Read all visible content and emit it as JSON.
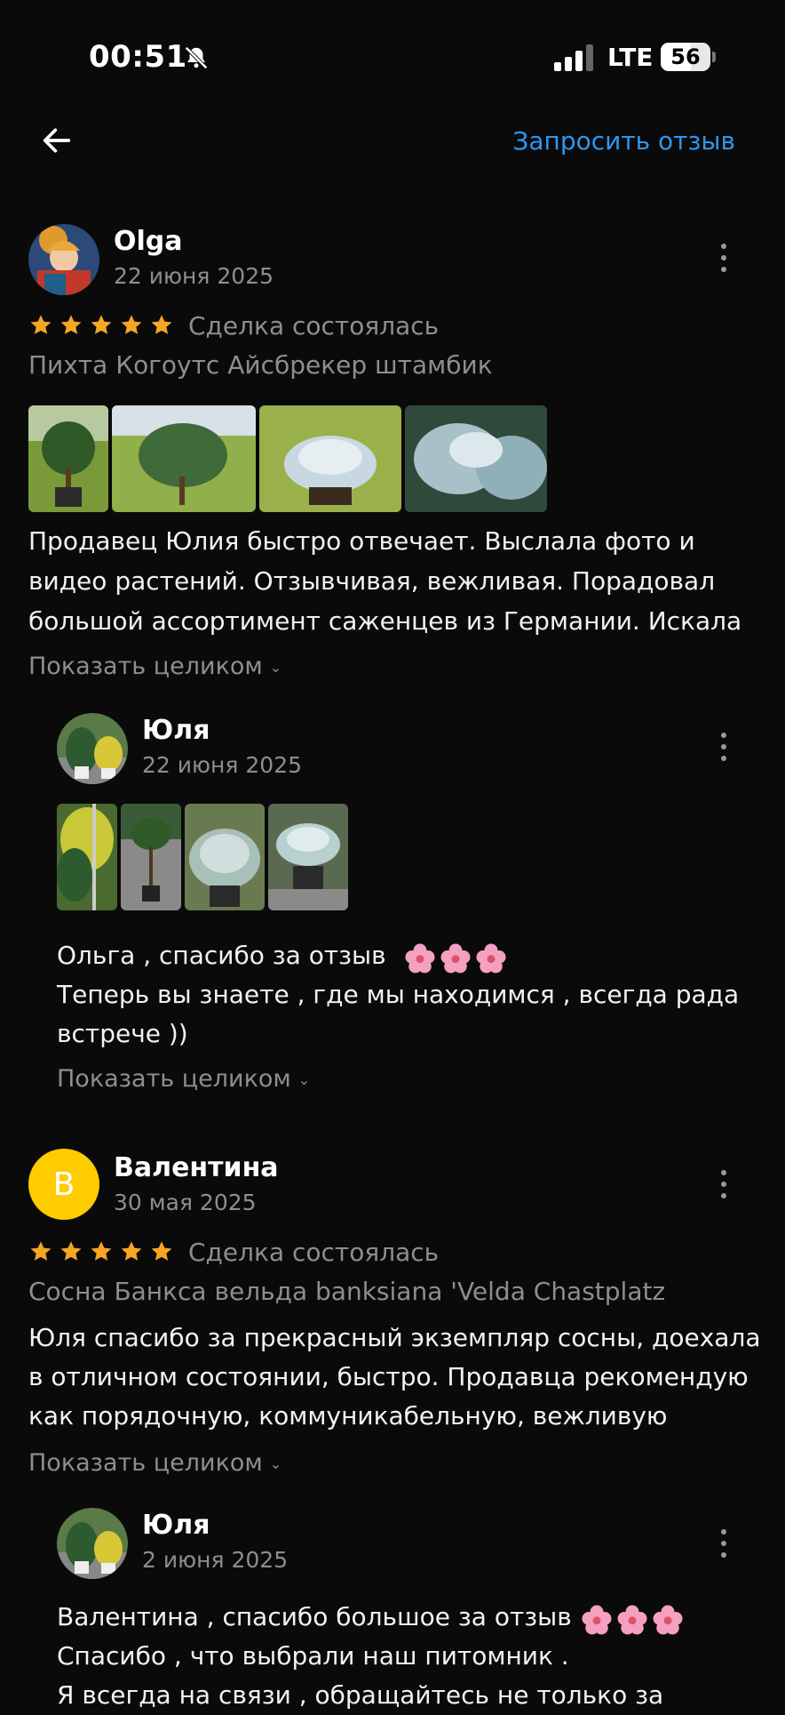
{
  "status": {
    "time": "00:51",
    "network": "LTE",
    "battery": "56"
  },
  "header": {
    "request_review": "Запросить отзыв"
  },
  "reviews": [
    {
      "author": "Olga",
      "date": "22 июня 2025",
      "rating": 5,
      "deal_status": "Сделка состоялась",
      "product": "Пихта Когоутс Айсбрекер штамбик",
      "text_lines": [
        "Продавец Юлия  быстро отвечает. Выслала фото и",
        "видео растений. Отзывчивая, вежливая. Порадовал",
        "большой ассортимент саженцев из Германии. Искала"
      ],
      "show_all": "Показать целиком",
      "reply": {
        "author": "Юля",
        "date": "22 июня 2025",
        "text_lines": [
          "Ольга , спасибо за отзыв",
          "Теперь вы знаете , где мы находимся , всегда рада",
          "встрече ))"
        ],
        "show_all": "Показать целиком"
      }
    },
    {
      "author": "Валентина",
      "avatar_letter": "В",
      "avatar_color": "#ffcc00",
      "date": "30 мая 2025",
      "rating": 5,
      "deal_status": "Сделка состоялась",
      "product": "Сосна Банкса вельда banksiana 'Velda Chastplatz",
      "text_lines": [
        "Юля спасибо за прекрасный экземпляр сосны, доехала",
        "в отличном состоянии, быстро. Продавца рекомендую",
        "как порядочную, коммуникабельную, вежливую"
      ],
      "show_all": "Показать целиком",
      "reply": {
        "author": "Юля",
        "date": "2 июня 2025",
        "text_lines": [
          "Валентина , спасибо большое за отзыв",
          "Спасибо , что выбрали наш питомник .",
          "Я всегда на связи , обращайтесь не только за"
        ]
      }
    }
  ],
  "colors": {
    "accent": "#2d97f0",
    "star": "#f5a623",
    "muted": "#8e8e8e",
    "background": "#0a0a0a"
  }
}
